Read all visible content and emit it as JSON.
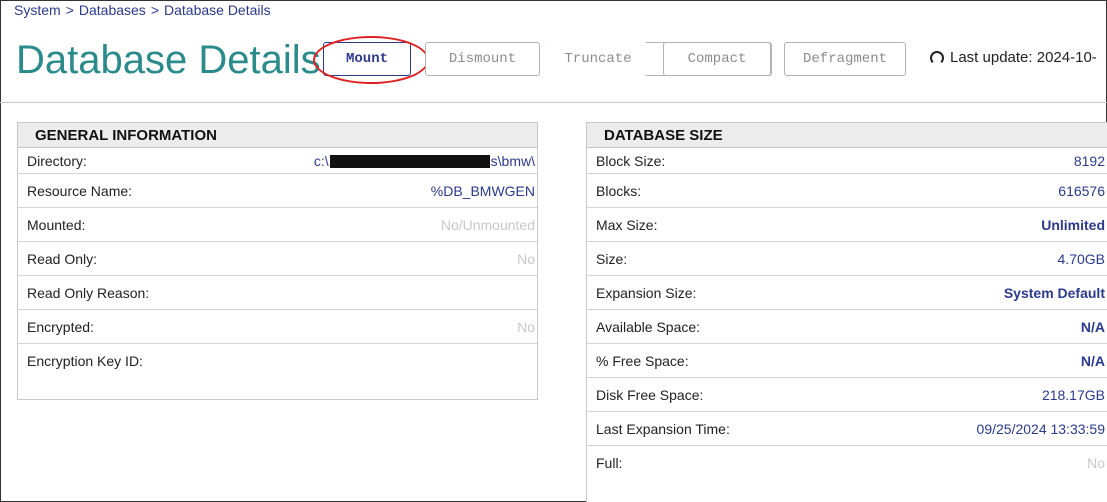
{
  "breadcrumb": {
    "items": [
      "System",
      "Databases",
      "Database Details"
    ],
    "sep": ">"
  },
  "page": {
    "title": "Database Details",
    "last_update": "Last update: 2024-10-"
  },
  "toolbar": {
    "mount": "Mount",
    "dismount": "Dismount",
    "truncate": "Truncate",
    "compact": "Compact",
    "defragment": "Defragment"
  },
  "general": {
    "title": "GENERAL INFORMATION",
    "directory_label": "Directory:",
    "directory_prefix": "c:\\",
    "directory_suffix": "s\\bmw\\",
    "resource_name_label": "Resource Name:",
    "resource_name_value": "%DB_BMWGEN",
    "mounted_label": "Mounted:",
    "mounted_value": "No/Unmounted",
    "read_only_label": "Read Only:",
    "read_only_value": "No",
    "read_only_reason_label": "Read Only Reason:",
    "read_only_reason_value": "",
    "encrypted_label": "Encrypted:",
    "encrypted_value": "No",
    "encryption_key_label": "Encryption Key ID:",
    "encryption_key_value": ""
  },
  "size": {
    "title": "DATABASE SIZE",
    "block_size_label": "Block Size:",
    "block_size_value": "8192",
    "blocks_label": "Blocks:",
    "blocks_value": "616576",
    "max_size_label": "Max Size:",
    "max_size_value": "Unlimited",
    "size_label": "Size:",
    "size_value": "4.70GB",
    "expansion_label": "Expansion Size:",
    "expansion_value": "System Default",
    "available_label": "Available Space:",
    "available_value": "N/A",
    "free_pct_label": "% Free Space:",
    "free_pct_value": "N/A",
    "disk_free_label": "Disk Free Space:",
    "disk_free_value": "218.17GB",
    "last_exp_label": "Last Expansion Time:",
    "last_exp_value": "09/25/2024 13:33:59",
    "full_label": "Full:",
    "full_value": "No"
  },
  "colors": {
    "title": "#2b8b8b",
    "link": "#2b3a8c",
    "highlight": "#e02020",
    "muted": "#c8c8c8"
  }
}
